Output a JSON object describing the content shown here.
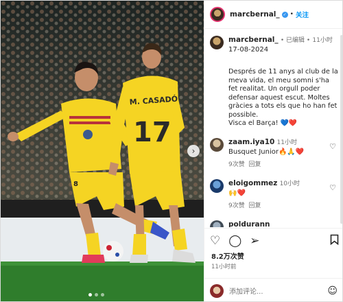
{
  "post": {
    "author": "marcbernal_",
    "follow_label": "关注",
    "separator": "•",
    "caption_author": "marcbernal_",
    "edited": "• 已编辑 •",
    "time_ago": "11小时",
    "date": "17-08-2024",
    "caption": "Després de 11 anys al club de la meva vida, el meu somni s'ha fet realitat. Un orgull poder defensar aquest escut. Moltes gràcies a tots els que ho han fet possible.\nVisca el Barça! 💙❤️",
    "likes": "8.2万次赞",
    "posted": "11小时前"
  },
  "comments": [
    {
      "user": "zaam.iya10",
      "time": "11小时",
      "text": "Busquet Junior🔥🙏❤️",
      "likes": "9次赞",
      "reply": "回复"
    },
    {
      "user": "eloigommez",
      "time": "10小时",
      "text": "🙌❤️",
      "likes": "9次赞",
      "reply": "回复"
    },
    {
      "user": "poldurann",
      "time": "11小时",
      "text": "",
      "likes": "",
      "reply": ""
    }
  ],
  "add_comment": {
    "placeholder": "添加评论..."
  },
  "photo": {
    "shirt_name": "M. CASADÓ",
    "shirt_number": "17",
    "player_number": "8"
  },
  "icons": {
    "like": "heart-icon",
    "comment": "comment-icon",
    "share": "share-icon",
    "save": "bookmark-icon",
    "emoji": "emoji-icon",
    "next": "chevron-right-icon"
  },
  "colors": {
    "verified": "#3897f0",
    "follow": "#0095f6",
    "kit": "#f5d423"
  }
}
